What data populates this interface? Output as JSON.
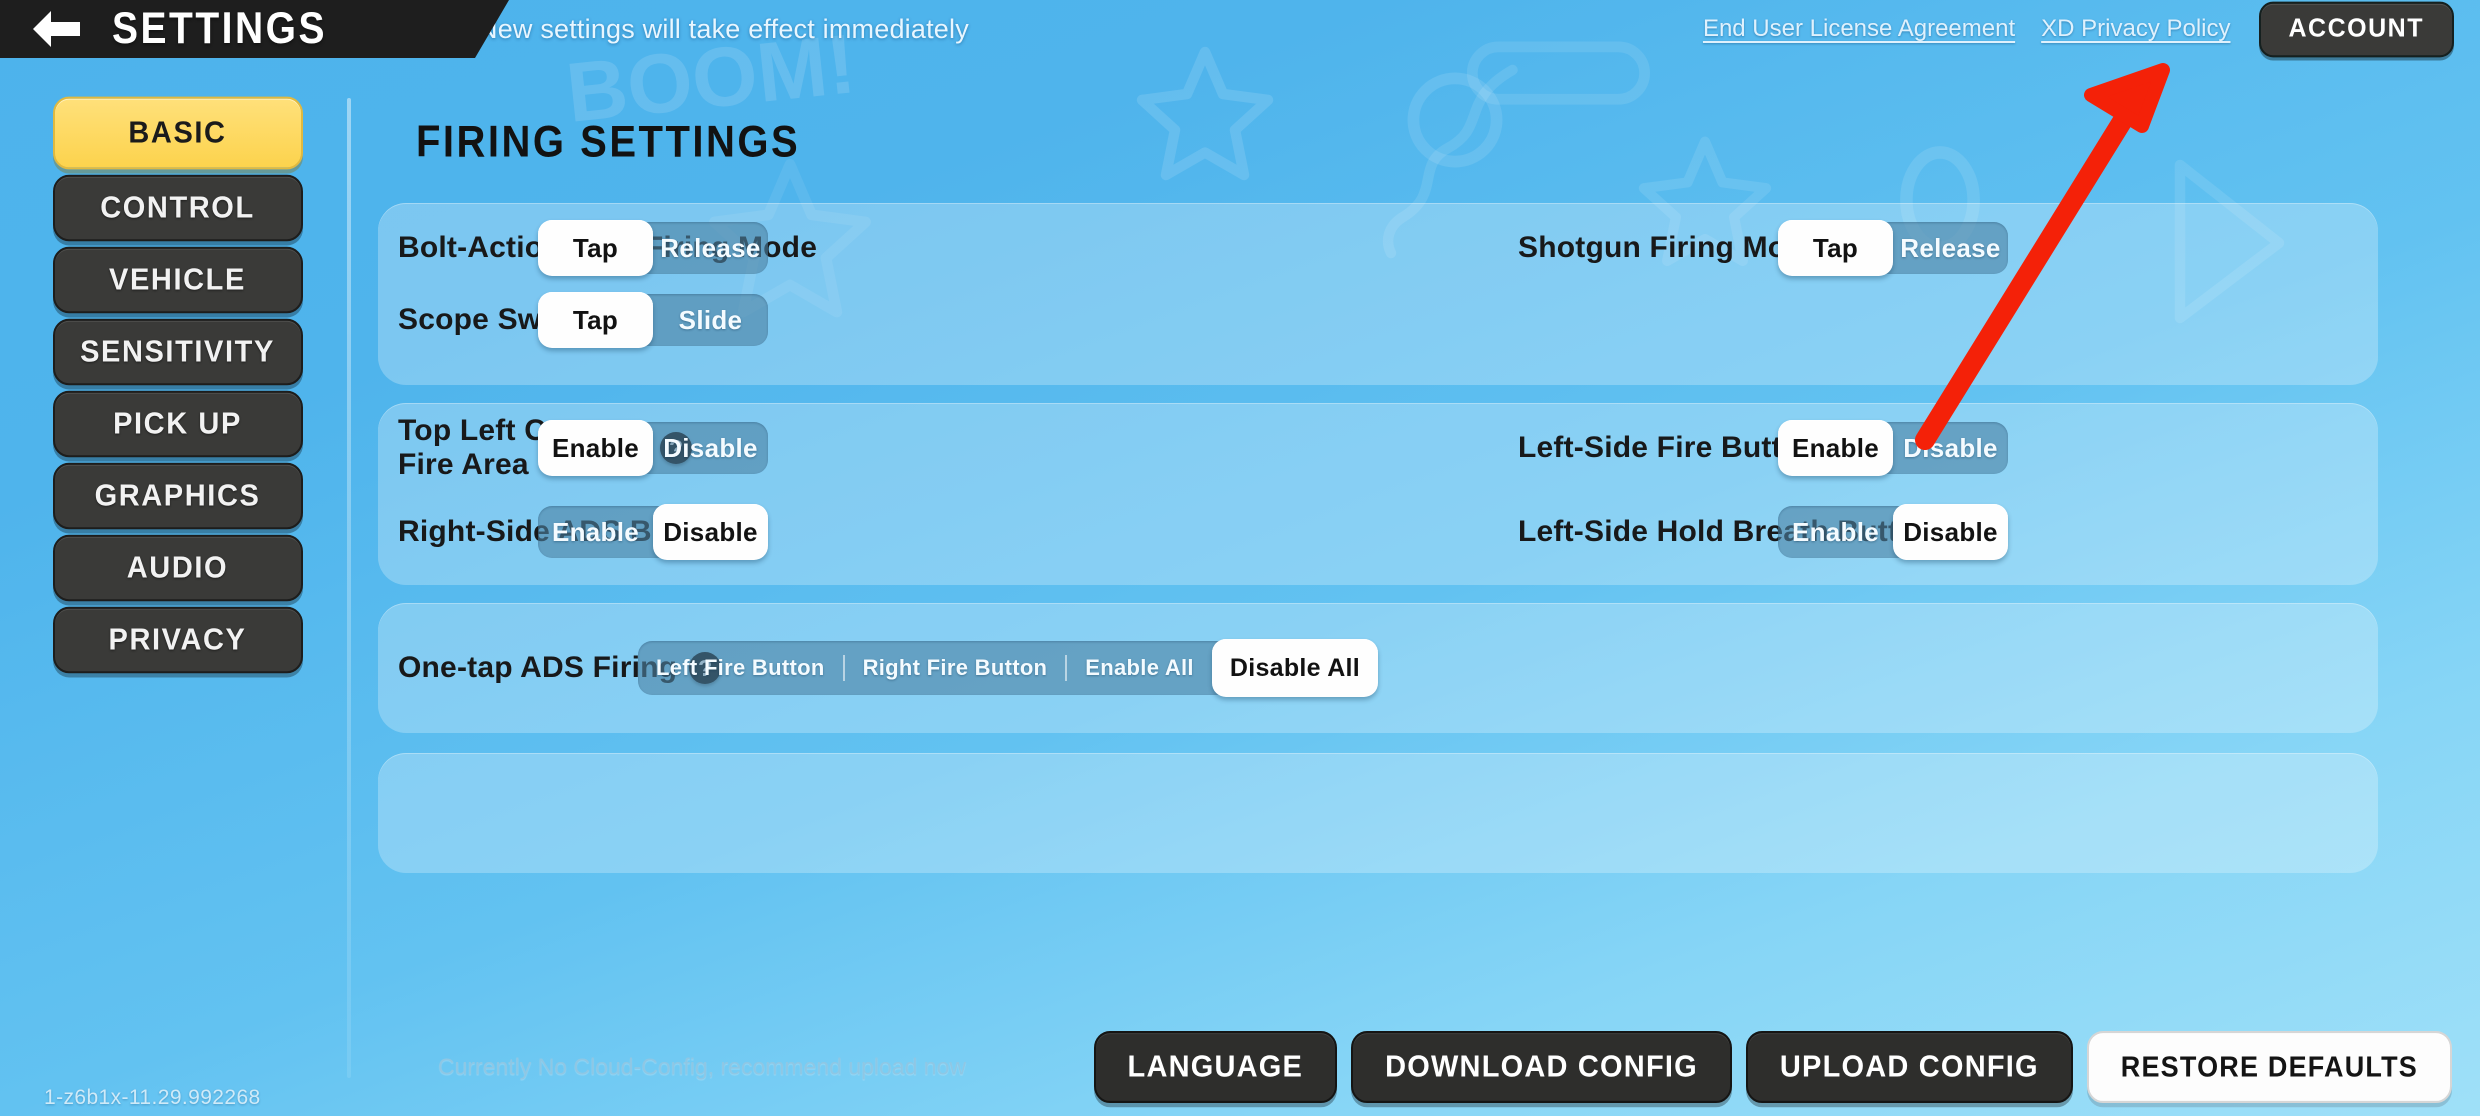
{
  "header": {
    "back_icon": "arrow-left-icon",
    "title": "SETTINGS",
    "notice": "New settings will take effect immediately",
    "eula_link": "End User License Agreement",
    "privacy_link": "XD Privacy Policy",
    "account_button": "ACCOUNT"
  },
  "sidebar": {
    "items": [
      {
        "label": "BASIC",
        "active": true
      },
      {
        "label": "CONTROL",
        "active": false
      },
      {
        "label": "VEHICLE",
        "active": false
      },
      {
        "label": "SENSITIVITY",
        "active": false
      },
      {
        "label": "PICK UP",
        "active": false
      },
      {
        "label": "GRAPHICS",
        "active": false
      },
      {
        "label": "AUDIO",
        "active": false
      },
      {
        "label": "PRIVACY",
        "active": false
      }
    ]
  },
  "main": {
    "page_title": "FIRING SETTINGS",
    "panels": [
      {
        "rows": [
          {
            "label": "Bolt-Action Rifle Firing Mode",
            "help": false,
            "options": [
              "Tap",
              "Release"
            ],
            "selected": "Tap"
          },
          {
            "label": "Shotgun Firing Mode",
            "help": false,
            "options": [
              "Tap",
              "Release"
            ],
            "selected": "Tap"
          },
          {
            "label": "Scope Switch",
            "help": false,
            "options": [
              "Tap",
              "Slide"
            ],
            "selected": "Tap"
          }
        ]
      },
      {
        "rows": [
          {
            "label": "Top Left Corner Fire Area",
            "help": true,
            "options": [
              "Enable",
              "Disable"
            ],
            "selected": "Enable"
          },
          {
            "label": "Left-Side Fire Button",
            "help": false,
            "options": [
              "Enable",
              "Disable"
            ],
            "selected": "Enable"
          },
          {
            "label": "Right-Side ADS Button",
            "help": false,
            "options": [
              "Enable",
              "Disable"
            ],
            "selected": "Disable"
          },
          {
            "label": "Left-Side Hold Breath Button",
            "help": false,
            "options": [
              "Enable",
              "Disable"
            ],
            "selected": "Disable"
          }
        ]
      },
      {
        "rows": [
          {
            "label": "One-tap ADS Firing",
            "help": true,
            "options": [
              "Left Fire Button",
              "Right Fire Button",
              "Enable All",
              "Disable All"
            ],
            "selected": "Disable All"
          }
        ]
      }
    ]
  },
  "footer": {
    "cloud_note": "Currently No Cloud-Config, recommend upload now",
    "buttons": [
      {
        "label": "LANGUAGE",
        "style": "dark"
      },
      {
        "label": "DOWNLOAD CONFIG",
        "style": "dark"
      },
      {
        "label": "UPLOAD CONFIG",
        "style": "dark"
      },
      {
        "label": "RESTORE DEFAULTS",
        "style": "light"
      }
    ]
  },
  "version": "1-z6b1x-11.29.992268",
  "annotation": {
    "type": "arrow",
    "color": "#F42108",
    "points_to": "account-button"
  },
  "colors": {
    "accent_yellow": "#FCD34D",
    "panel_dark": "#3A3A38",
    "bg_blue_top": "#4DB3EC",
    "bg_blue_bottom": "#9FE0F8",
    "segment_track": "#4C82A3",
    "annotation_red": "#F42108"
  }
}
